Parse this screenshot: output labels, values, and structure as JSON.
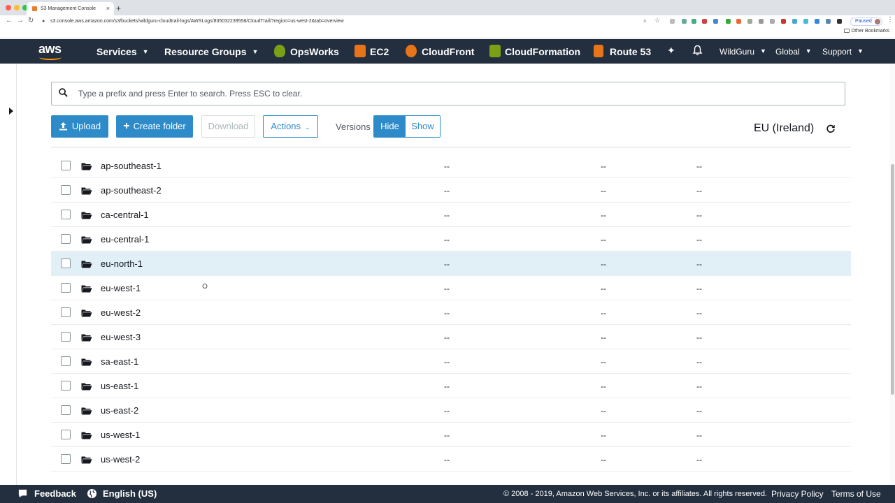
{
  "browser": {
    "tab_title": "S3 Management Console",
    "url": "s3.console.aws.amazon.com/s3/buckets/wildguru-cloudtrail-logs/AWSLogs/835032239558/CloudTrail/?region=us-west-2&tab=overview",
    "profile_status": "Paused",
    "bookmarks_label": "Other Bookmarks"
  },
  "nav": {
    "logo": "aws",
    "services": "Services",
    "resource_groups": "Resource Groups",
    "shortcuts": [
      "OpsWorks",
      "EC2",
      "CloudFront",
      "CloudFormation",
      "Route 53"
    ],
    "account": "WildGuru",
    "region_menu": "Global",
    "support": "Support"
  },
  "search": {
    "placeholder": "Type a prefix and press Enter to search. Press ESC to clear.",
    "value": ""
  },
  "actions": {
    "upload": "Upload",
    "create_folder": "Create folder",
    "download": "Download",
    "actions": "Actions",
    "versions_label": "Versions",
    "hide": "Hide",
    "show": "Show",
    "region": "EU (Ireland)"
  },
  "rows": [
    {
      "name": "ap-southeast-1",
      "c1": "--",
      "c2": "--",
      "c3": "--"
    },
    {
      "name": "ap-southeast-2",
      "c1": "--",
      "c2": "--",
      "c3": "--"
    },
    {
      "name": "ca-central-1",
      "c1": "--",
      "c2": "--",
      "c3": "--"
    },
    {
      "name": "eu-central-1",
      "c1": "--",
      "c2": "--",
      "c3": "--"
    },
    {
      "name": "eu-north-1",
      "c1": "--",
      "c2": "--",
      "c3": "--"
    },
    {
      "name": "eu-west-1",
      "c1": "--",
      "c2": "--",
      "c3": "--"
    },
    {
      "name": "eu-west-2",
      "c1": "--",
      "c2": "--",
      "c3": "--"
    },
    {
      "name": "eu-west-3",
      "c1": "--",
      "c2": "--",
      "c3": "--"
    },
    {
      "name": "sa-east-1",
      "c1": "--",
      "c2": "--",
      "c3": "--"
    },
    {
      "name": "us-east-1",
      "c1": "--",
      "c2": "--",
      "c3": "--"
    },
    {
      "name": "us-east-2",
      "c1": "--",
      "c2": "--",
      "c3": "--"
    },
    {
      "name": "us-west-1",
      "c1": "--",
      "c2": "--",
      "c3": "--"
    },
    {
      "name": "us-west-2",
      "c1": "--",
      "c2": "--",
      "c3": "--"
    }
  ],
  "footer": {
    "feedback": "Feedback",
    "language": "English (US)",
    "copyright": "© 2008 - 2019, Amazon Web Services, Inc. or its affiliates. All rights reserved.",
    "privacy": "Privacy Policy",
    "terms": "Terms of Use"
  },
  "colors": {
    "nav_bg": "#232f3e",
    "primary": "#2e8bc9",
    "row_highlight": "#e1eff7",
    "aws_orange": "#ff9900"
  }
}
